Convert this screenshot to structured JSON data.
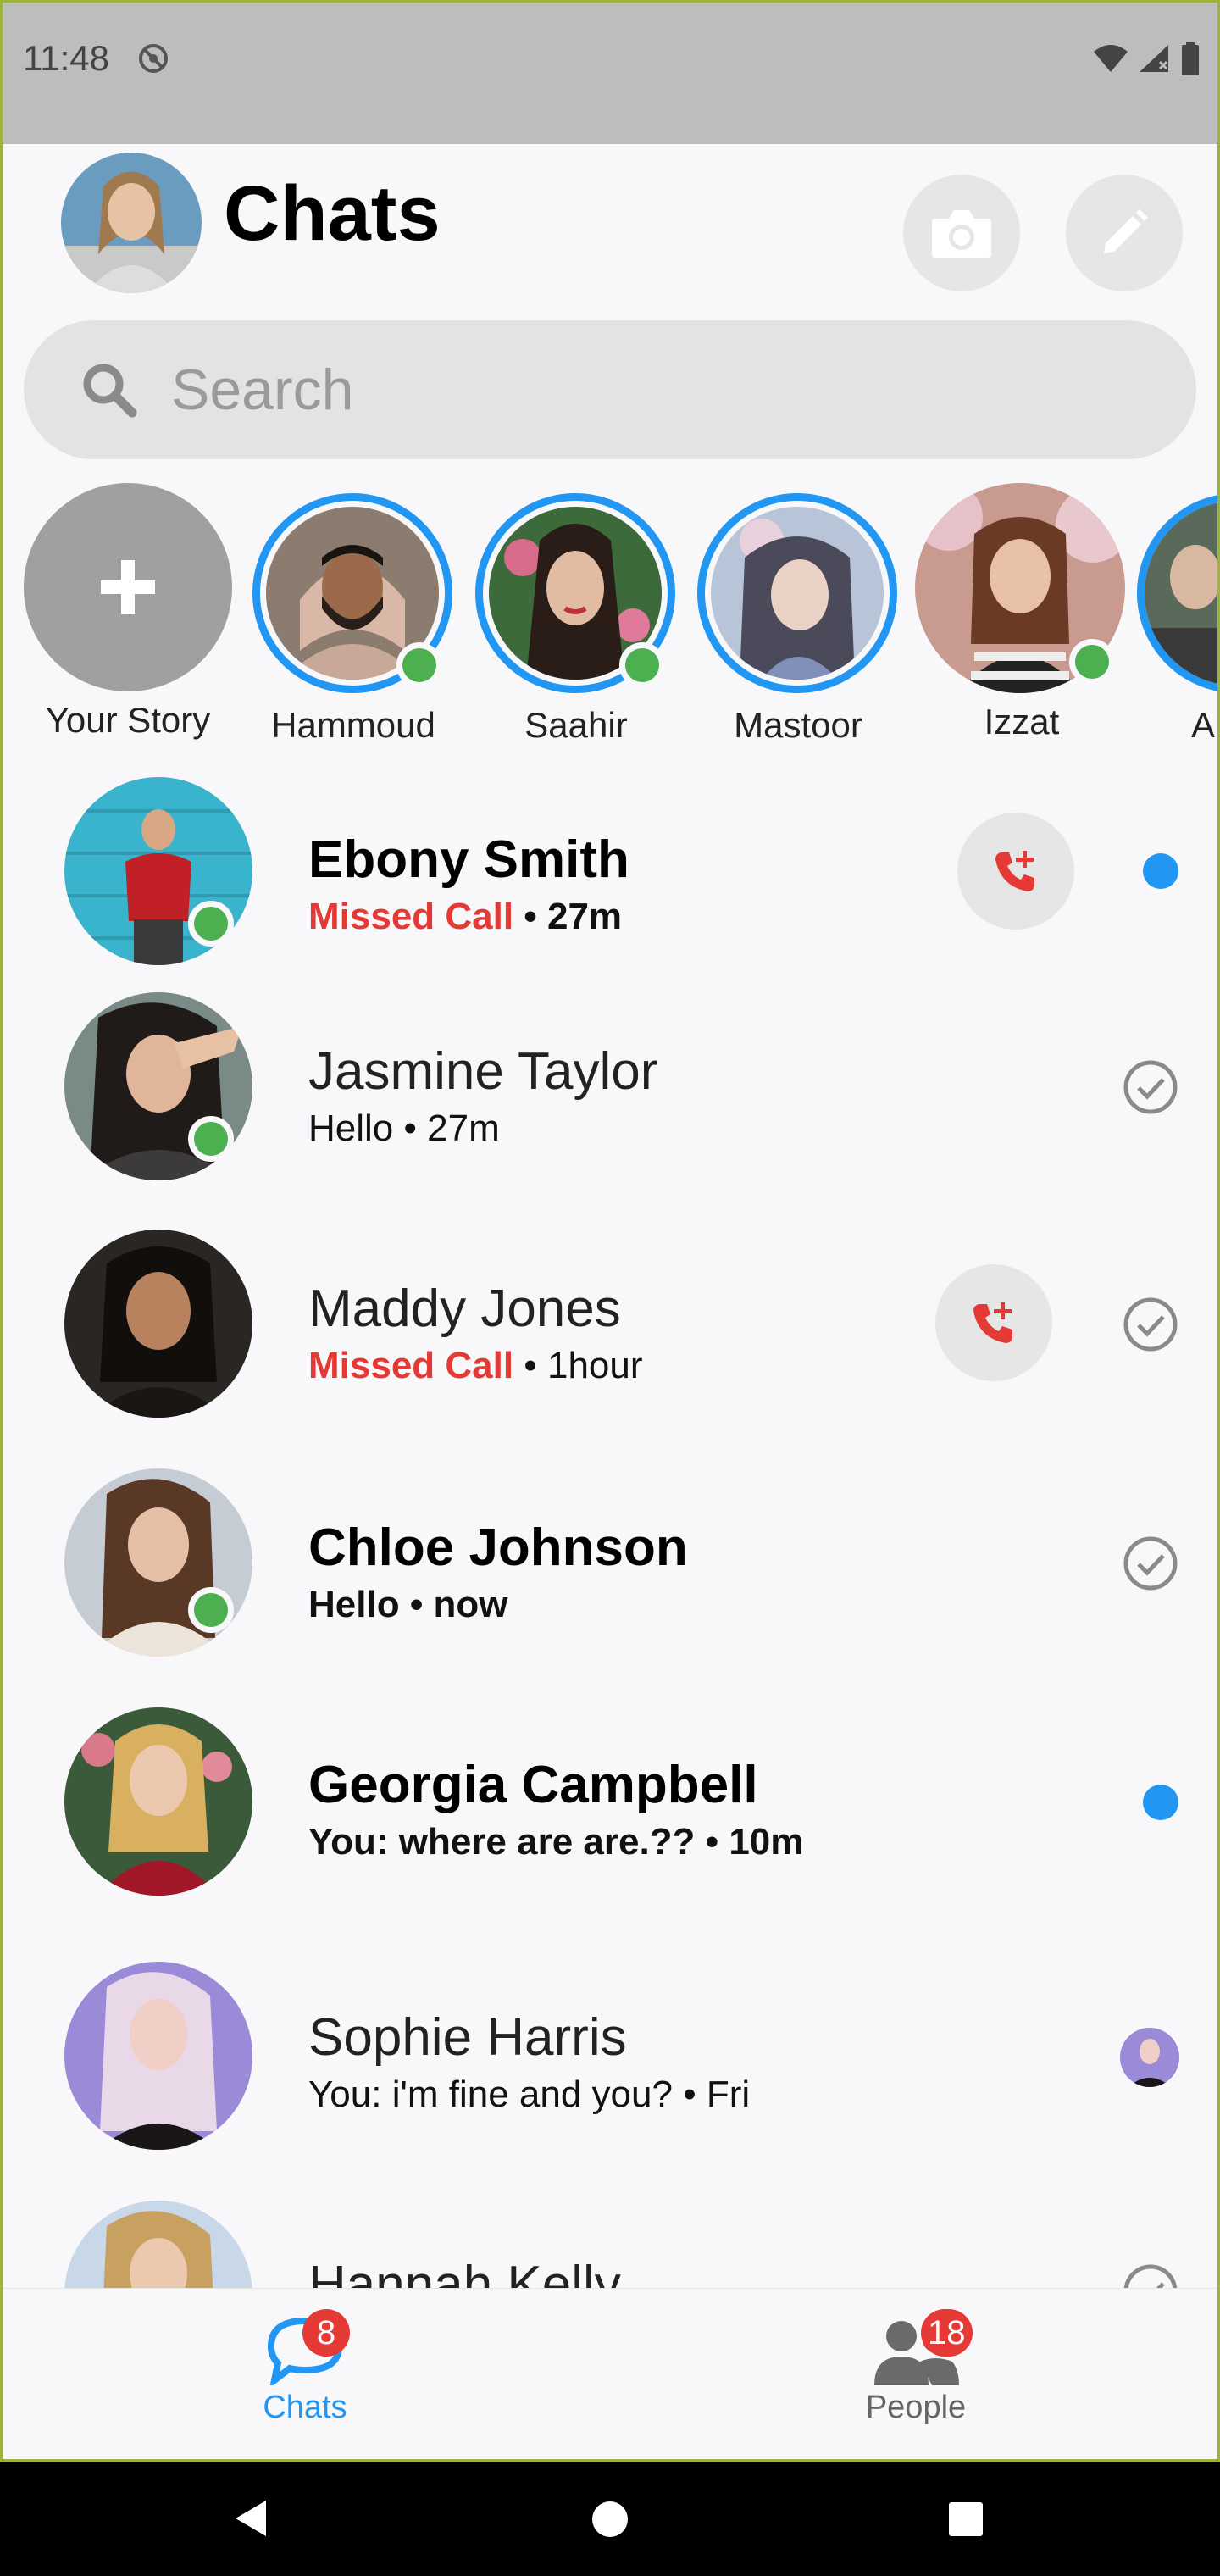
{
  "status_bar": {
    "time": "11:48"
  },
  "header": {
    "title": "Chats"
  },
  "search": {
    "placeholder": "Search"
  },
  "stories": [
    {
      "name": "Your Story"
    },
    {
      "name": "Hammoud"
    },
    {
      "name": "Saahir"
    },
    {
      "name": "Mastoor"
    },
    {
      "name": "Izzat"
    },
    {
      "name": "A"
    }
  ],
  "chats": [
    {
      "name": "Ebony Smith",
      "preview": "Missed Call",
      "time": "27m"
    },
    {
      "name": "Jasmine Taylor",
      "preview": "Hello",
      "time": "27m"
    },
    {
      "name": "Maddy Jones",
      "preview": "Missed Call",
      "time": "1hour"
    },
    {
      "name": "Chloe Johnson",
      "preview": "Hello",
      "time": "now"
    },
    {
      "name": "Georgia Campbell",
      "preview": "You: where are are.??",
      "time": "10m"
    },
    {
      "name": "Sophie Harris",
      "preview": "You: i'm fine and you?",
      "time": "Fri"
    },
    {
      "name": "Hannah Kelly",
      "preview": "",
      "time": ""
    }
  ],
  "separator": "•",
  "bottom_nav": {
    "chats": {
      "label": "Chats",
      "badge": "8"
    },
    "people": {
      "label": "People",
      "badge": "18"
    }
  },
  "colors": {
    "accent": "#2196f3",
    "missed": "#e53935",
    "online": "#4caf50",
    "badge": "#e53935"
  },
  "icons": {
    "camera": "camera-icon",
    "compose": "pencil-icon",
    "search": "search-icon",
    "add_call": "add-call-icon",
    "read": "check-circle-icon",
    "chats_tab": "chat-bubble-icon",
    "people_tab": "people-icon"
  }
}
